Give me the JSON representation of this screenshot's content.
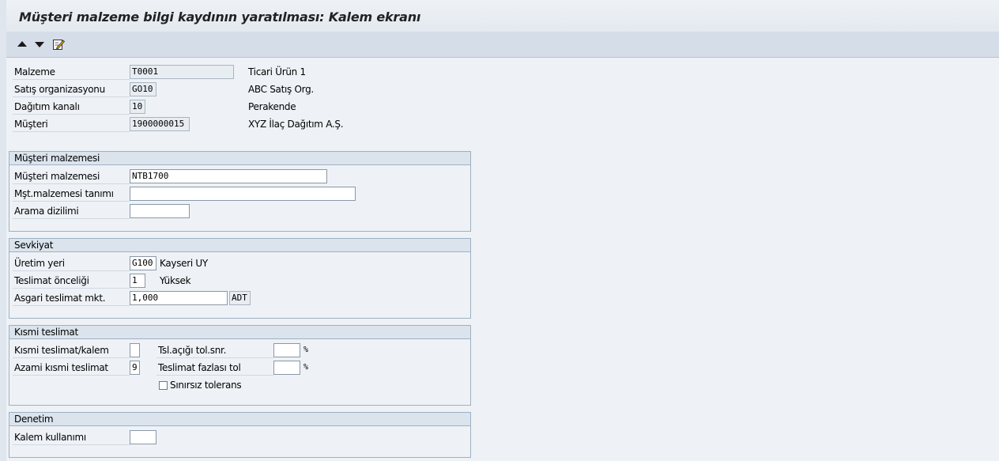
{
  "title": "Müşteri malzeme bilgi kaydının yaratılması: Kalem ekranı",
  "toolbar": {
    "icons": [
      "arrow-up-icon",
      "arrow-down-icon",
      "edit-icon"
    ]
  },
  "header": {
    "material_label": "Malzeme",
    "material_value": "T0001",
    "material_desc": "Ticari Ürün 1",
    "salesorg_label": "Satış organizasyonu",
    "salesorg_value": "GO10",
    "salesorg_desc": "ABC Satış Org.",
    "channel_label": "Dağıtım kanalı",
    "channel_value": "10",
    "channel_desc": "Perakende",
    "customer_label": "Müşteri",
    "customer_value": "1900000015",
    "customer_desc": "XYZ İlaç Dağıtım A.Ş."
  },
  "cust_material": {
    "title": "Müşteri malzemesi",
    "material_label": "Müşteri malzemesi",
    "material_value": "NTB1700",
    "desc_label": "Mşt.malzemesi tanımı",
    "desc_value": "",
    "search_label": "Arama dizilimi",
    "search_value": ""
  },
  "shipping": {
    "title": "Sevkiyat",
    "plant_label": "Üretim yeri",
    "plant_value": "G100",
    "plant_desc": "Kayseri UY",
    "priority_label": "Teslimat önceliği",
    "priority_value": "1",
    "priority_desc": "Yüksek",
    "minqty_label": "Asgari teslimat mkt.",
    "minqty_value": "1,000",
    "unit_value": "ADT"
  },
  "partial": {
    "title": "Kısmi teslimat",
    "item_label": "Kısmi teslimat/kalem",
    "item_value": "",
    "max_label": "Azami kısmi teslimat",
    "max_value": "9",
    "under_label": "Tsl.açığı tol.snr.",
    "under_value": "",
    "under_unit": "%",
    "over_label": "Teslimat fazlası tol",
    "over_value": "",
    "over_unit": "%",
    "unlimited_label": "Sınırsız tolerans"
  },
  "control": {
    "title": "Denetim",
    "usage_label": "Kalem kullanımı",
    "usage_value": ""
  }
}
